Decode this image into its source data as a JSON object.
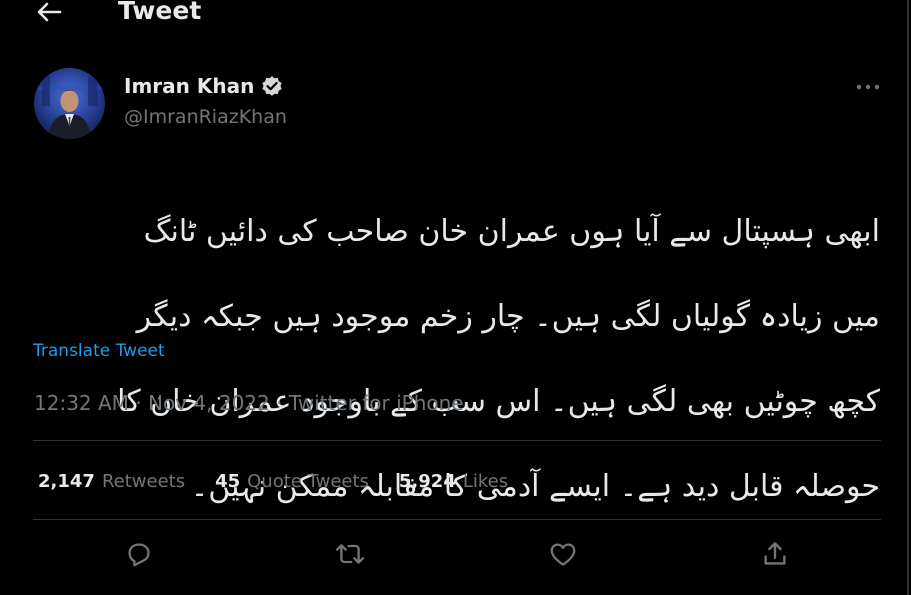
{
  "header": {
    "title": "Tweet",
    "back_icon": "arrow-left-icon"
  },
  "author": {
    "name": "Imran Khan",
    "handle": "@ImranRiazKhan",
    "verified_icon": "verified-badge-icon",
    "verified_color": "#d6d9db"
  },
  "tweet": {
    "lines": [
      "ابھی ہسپتال سے آیا ہوں عمران خان صاحب کی دائیں ٹانگ",
      "میں زیادہ گولیاں لگی ہیں۔ چار زخم موجود ہیں جبکہ دیگر",
      "کچھ چوٹیں بھی لگی ہیں۔ اس سب کے باوجود عمران خان کا",
      "حوصلہ قابل دید ہے۔ ایسے آدمی کا مقابلہ ممکن نہیں۔"
    ],
    "translate_label": "Translate Tweet"
  },
  "meta": {
    "time": "12:32 AM",
    "date": "Nov 4, 2022",
    "source": "Twitter for iPhone",
    "separator": "·"
  },
  "stats": {
    "retweets_count": "2,147",
    "retweets_label": "Retweets",
    "quotes_count": "45",
    "quotes_label": "Quote Tweets",
    "likes_count": "5,924",
    "likes_label": "Likes"
  },
  "actions": [
    "reply-icon",
    "retweet-icon",
    "like-icon",
    "share-icon"
  ],
  "colors": {
    "background": "#000000",
    "text": "#e7e9ea",
    "muted": "#71767b",
    "link": "#1d9bf0",
    "divider": "#2f3336"
  }
}
